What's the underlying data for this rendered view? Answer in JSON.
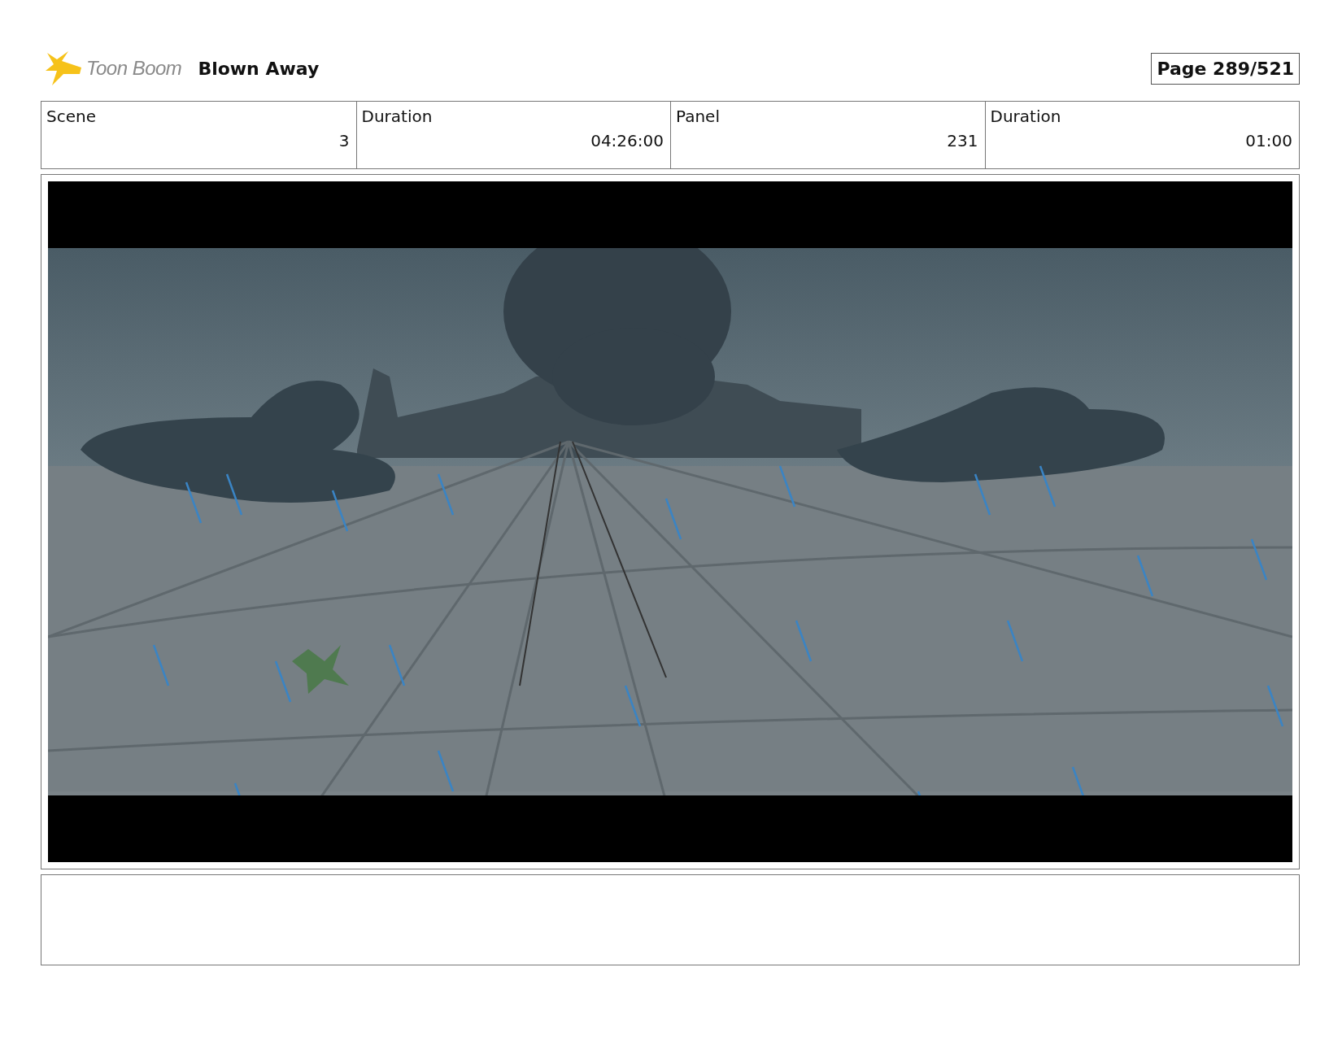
{
  "header": {
    "logo": "Toon Boom",
    "title": "Blown Away",
    "page": "Page 289/521"
  },
  "info": {
    "columns": [
      "Scene",
      "Duration",
      "Panel",
      "Duration"
    ],
    "rows": [
      [
        "3",
        "04:26:00",
        "231",
        "01:00"
      ]
    ]
  }
}
